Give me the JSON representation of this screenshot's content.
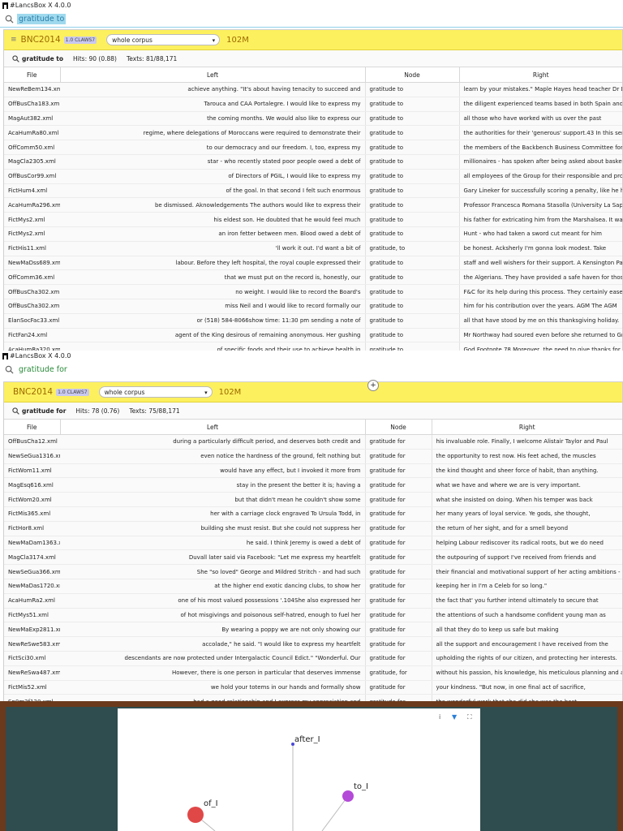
{
  "app": {
    "title": "#LancsBox X 4.0.0"
  },
  "panel1": {
    "query": "gratitude to",
    "corpus": "BNC2014",
    "corpus_badge": "1.0 CLAWS7",
    "scope": "whole corpus",
    "size": "102M",
    "search_term": "gratitude to",
    "hits": "Hits: 90 (0.88)",
    "texts": "Texts: 81/88,171",
    "columns": {
      "file": "File",
      "left": "Left",
      "node": "Node",
      "right": "Right"
    },
    "rows": [
      {
        "file": "NewReBem134.xml",
        "left": "achieve anything. \"It's about having tenacity to succeed and",
        "node": "gratitude to",
        "right": "learn by your mistakes.\" Maple Hayes head teacher Dr Da"
      },
      {
        "file": "OffBusCha183.xml",
        "left": "Tarouca and CAA Portalegre. I would like to express my",
        "node": "gratitude to",
        "right": "the diligent experienced teams based in both Spain and P"
      },
      {
        "file": "MagAut382.xml",
        "left": "the coming months. We would also like to express our",
        "node": "gratitude to",
        "right": "all those who have worked with us over the past"
      },
      {
        "file": "AcaHumRa80.xml",
        "left": "regime, where delegations of Moroccans were required to demonstrate their",
        "node": "gratitude to",
        "right": "the authorities for their 'generous' support.43 In this sens"
      },
      {
        "file": "OffComm50.xml",
        "left": "to our democracy and our freedom. I, too, express my",
        "node": "gratitude to",
        "right": "the members of the Backbench Business Committee for a"
      },
      {
        "file": "MagCla2305.xml",
        "left": "star - who recently stated poor people owed a debt of",
        "node": "gratitude to",
        "right": "millionaires - has spoken after being asked about baskett"
      },
      {
        "file": "OffBusCor99.xml",
        "left": "of Directors of PGIL, I would like to express my",
        "node": "gratitude to",
        "right": "all employees of the Group for their responsible and prof"
      },
      {
        "file": "FictHum4.xml",
        "left": "of the goal. In that second I felt such enormous",
        "node": "gratitude to",
        "right": "Gary Lineker for successfully scoring a penalty, like he ha"
      },
      {
        "file": "AcaHumRa296.xml",
        "left": "be dismissed.   Aknowledgements The authors would like to express their",
        "node": "gratitude to",
        "right": "Professor Francesca Romana Stasolla (University La Sapie"
      },
      {
        "file": "FictMys2.xml",
        "left": "his eldest son. He doubted that he would feel much",
        "node": "gratitude to",
        "right": "his father for extricating him from the Marshalsea. It was"
      },
      {
        "file": "FictMys2.xml",
        "left": "an iron fetter between men. Blood owed a debt of",
        "node": "gratitude to",
        "right": "Hunt - who had taken a sword cut meant for him"
      },
      {
        "file": "FictHis11.xml",
        "left": "'ll work it out. I'd want a bit of",
        "node": "gratitude, to",
        "right": "be honest. Acksherly I'm gonna look modest. Take"
      },
      {
        "file": "NewMaDss689.xml",
        "left": "labour. Before they left hospital, the royal couple expressed their",
        "node": "gratitude to",
        "right": "staff and well wishers for their support. A Kensington Pala"
      },
      {
        "file": "OffComm36.xml",
        "left": "that we must put on the record is, honestly, our",
        "node": "gratitude to",
        "right": "the Algerians. They have provided a safe haven for those"
      },
      {
        "file": "OffBusCha302.xml",
        "left": "no weight. I would like to record the Board's",
        "node": "gratitude to",
        "right": "F&C for its help during this process. They certainly eased"
      },
      {
        "file": "OffBusCha302.xml",
        "left": "miss Neil and I would like to record formally our",
        "node": "gratitude to",
        "right": "him for his contribution over the years. AGM The AGM"
      },
      {
        "file": "ElanSocFac33.xml",
        "left": "or (518) 584-8066show time: 11:30 pm   sending a note of",
        "node": "gratitude to",
        "right": "all that have stood by me on this thanksgiving holiday."
      },
      {
        "file": "FictFan24.xml",
        "left": "agent of the King desirous of remaining anonymous. Her gushing",
        "node": "gratitude to",
        "right": "Mr Northway had soured even before she returned to Gra"
      },
      {
        "file": "AcaHumRa320.xml",
        "left": "of specific foods and their use to achieve health in",
        "node": "gratitude to",
        "right": "God.Footnote 78 Moreover, the need to give thanks for t"
      }
    ]
  },
  "panel2": {
    "query": "gratitude for",
    "corpus": "BNC2014",
    "corpus_badge": "1.0 CLAWS7",
    "scope": "whole corpus",
    "size": "102M",
    "search_term": "gratitude for",
    "hits": "Hits: 78 (0.76)",
    "texts": "Texts: 75/88,171",
    "columns": {
      "file": "File",
      "left": "Left",
      "node": "Node",
      "right": "Right"
    },
    "rows": [
      {
        "file": "OffBusCha12.xml",
        "left": "during a particularly difficult period, and deserves both credit and",
        "node": "gratitude for",
        "right": "his invaluable role. Finally, I welcome Alistair Taylor and Paul"
      },
      {
        "file": "NewSeGua1316.xml",
        "left": "even notice the hardness of the ground, felt nothing but",
        "node": "gratitude for",
        "right": "the opportunity to rest now. His feet ached, the muscles"
      },
      {
        "file": "FictWom11.xml",
        "left": "would have any effect, but I invoked it more from",
        "node": "gratitude for",
        "right": "the kind thought and sheer force of habit, than anything."
      },
      {
        "file": "MagEsq616.xml",
        "left": "stay in the present the better it is; having a",
        "node": "gratitude for",
        "right": "what we have and where we are is very important."
      },
      {
        "file": "FictWom20.xml",
        "left": "but that didn't mean he couldn't show some",
        "node": "gratitude for",
        "right": "what she insisted on doing. When his temper was back"
      },
      {
        "file": "FictMis365.xml",
        "left": "her with a carriage clock engraved To Ursula Todd, in",
        "node": "gratitude for",
        "right": "her many years of loyal service. Ye gods, she thought,"
      },
      {
        "file": "FictHor8.xml",
        "left": "building she must resist. But she could not suppress her",
        "node": "gratitude for",
        "right": "the return of her sight, and for a smell beyond"
      },
      {
        "file": "NewMaDam1363.xml",
        "left": "he said. I think Jeremy is owed a debt of",
        "node": "gratitude for",
        "right": "helping Labour rediscover its radical roots, but we do need"
      },
      {
        "file": "MagCla3174.xml",
        "left": "Duvall later said via Facebook: \"Let me express my heartfelt",
        "node": "gratitude for",
        "right": "the outpouring of support I've received from friends and"
      },
      {
        "file": "NewSeGua366.xml",
        "left": "She \"so loved\" George and Mildred Stritch - and had such",
        "node": "gratitude for",
        "right": "their financial and motivational support of her acting ambitions - th"
      },
      {
        "file": "NewMaDas1720.xml",
        "left": "at the higher end exotic dancing clubs, to show her",
        "node": "gratitude for",
        "right": "keeping her in I'm a Celeb for so long.\""
      },
      {
        "file": "AcaHumRa2.xml",
        "left": "one of his most valued possessions '.104She also expressed her",
        "node": "gratitude for",
        "right": "the fact that' you further intend ultimately to secure that"
      },
      {
        "file": "FictMys51.xml",
        "left": "of hot misgivings and poisonous self-hatred, enough to fuel her",
        "node": "gratitude for",
        "right": "the attentions of such a handsome confident young man as"
      },
      {
        "file": "NewMaExp2811.xml",
        "left": "By wearing a poppy we are not only showing our",
        "node": "gratitude for",
        "right": "all that they do to keep us safe but making"
      },
      {
        "file": "NewReSwe583.xml",
        "left": "accolade,\" he said. \"I would like to express my heartfelt",
        "node": "gratitude for",
        "right": "all the support and encouragement I have received from the"
      },
      {
        "file": "FictSci30.xml",
        "left": "descendants are now protected under Intergalactic Council Edict.\" \"Wonderful. Our",
        "node": "gratitude for",
        "right": "upholding the rights of our citizen, and protecting her interests."
      },
      {
        "file": "NewReSwa487.xml",
        "left": "However, there is one person in particular that deserves immense",
        "node": "gratitude, for",
        "right": "without his passion, his knowledge, his meticulous planning and att"
      },
      {
        "file": "FictMis52.xml",
        "left": "we hold your totems in our hands and formally show",
        "node": "gratitude for",
        "right": "your kindness. \"But now, in one final act of sacrifice,"
      },
      {
        "file": "Sp0m2f120.xml",
        "left": "had a good relationship and I express my appreciation and",
        "node": "gratitude for",
        "right": "the wonderful work that she did she was the best"
      }
    ]
  },
  "graph": {
    "nodes": [
      {
        "label": "after_I",
        "color": "#4a4ad8"
      },
      {
        "label": "to_I",
        "color": "#b44ad8"
      },
      {
        "label": "of_I",
        "color": "#e04848"
      }
    ]
  }
}
